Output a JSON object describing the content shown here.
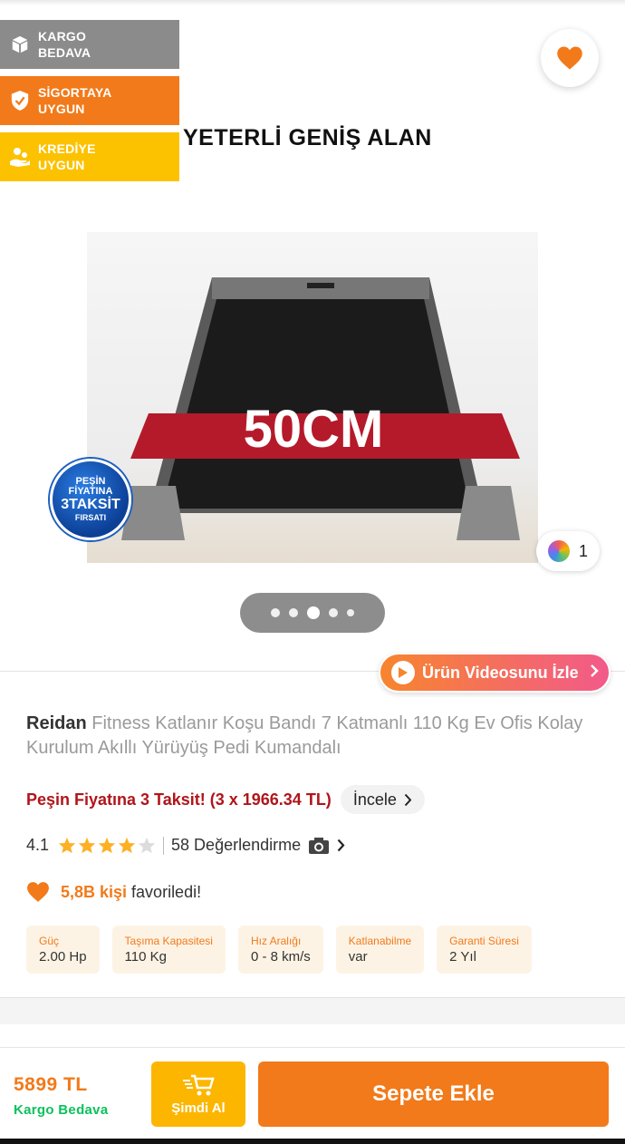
{
  "badges": [
    {
      "label": "KARGO BEDAVA",
      "icon": "box-icon",
      "color": "#8b8b8b"
    },
    {
      "label": "SİGORTAYA UYGUN",
      "icon": "shield-check-icon",
      "color": "#f27a1a"
    },
    {
      "label": "KREDİYE UYGUN",
      "icon": "hand-coins-icon",
      "color": "#fcc200"
    }
  ],
  "gallery": {
    "headline": "YETERLİ GENİŞ ALAN",
    "image_caption": "50CM",
    "campaign_badge": {
      "line1": "PEŞİN",
      "line2": "FİYATINA",
      "line3": "3TAKSİT",
      "line4": "FIRSATI"
    },
    "color_count": "1",
    "page_count": 5,
    "active_page": 2,
    "video_label": "Ürün Videosunu İzle"
  },
  "product": {
    "brand": "Reidan",
    "title": "Fitness Katlanır Koşu Bandı 7 Katmanlı 110 Kg Ev Ofis Kolay Kurulum Akıllı Yürüyüş Pedi Kumandalı",
    "promo_text": "Peşin Fiyatına 3 Taksit! (3 x 1966.34 TL)",
    "promo_link": "İncele",
    "rating": "4.1",
    "rating_value": 4.1,
    "review_count_label": "58 Değerlendirme",
    "fav_count": "5,8B kişi",
    "fav_suffix": "favoriledi!"
  },
  "specs": [
    {
      "label": "Güç",
      "value": "2.00 Hp"
    },
    {
      "label": "Taşıma Kapasitesi",
      "value": "110 Kg"
    },
    {
      "label": "Hız Aralığı",
      "value": "0 - 8 km/s"
    },
    {
      "label": "Katlanabilme",
      "value": "var"
    },
    {
      "label": "Garanti Süresi",
      "value": "2 Yıl"
    }
  ],
  "bottom_bar": {
    "price": "5899 TL",
    "shipping": "Kargo Bedava",
    "buy_now": "Şimdi Al",
    "add_to_cart": "Sepete Ekle"
  },
  "colors": {
    "accent": "#f27a1a",
    "promo_red": "#b0151a",
    "shipping_green": "#0bc15c",
    "buy_now_yellow": "#fcb600"
  }
}
